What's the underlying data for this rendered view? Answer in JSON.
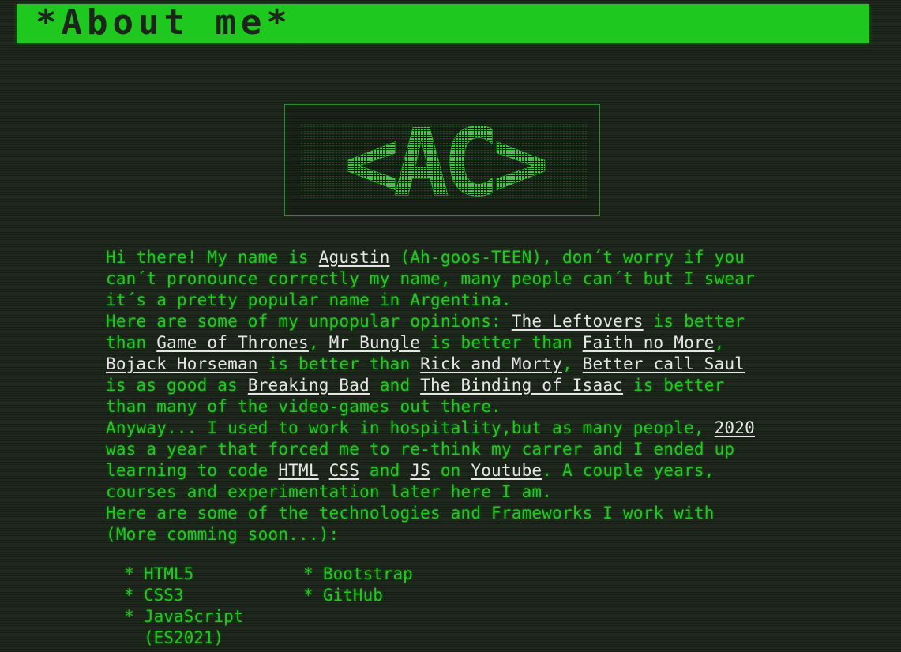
{
  "header": {
    "title": "*About me*"
  },
  "logo": {
    "text": "<AC>"
  },
  "intro": {
    "p1_a": "Hi there! My name is ",
    "name_link": "Agustin",
    "p1_b": " (Ah-goos-TEEN), don´t worry if you can´t pronounce correctly my name, many people can´t but I swear it´s a pretty popular name in Argentina."
  },
  "opinions": {
    "t1": "Here are some of my unpopular opinions: ",
    "link_leftovers": "The Leftovers",
    "t2": " is better than ",
    "link_got": "Game of Thrones",
    "t3": ", ",
    "link_mrbungle": "Mr Bungle",
    "t4": " is better than ",
    "link_faith": "Faith no More",
    "t5": ", ",
    "link_bojack": "Bojack Horseman",
    "t6": " is better than ",
    "link_rick": "Rick and Morty",
    "t7": ", ",
    "link_saul": "Better call Saul",
    "t8": " is as good as ",
    "link_bb": "Breaking Bad",
    "t9": " and ",
    "link_isaac": "The Binding of Isaac",
    "t10": " is better than many of the video-games out there."
  },
  "story": {
    "t1": "Anyway... I used to work in hospitality,but as many people, ",
    "link_2020": "2020",
    "t2": " was a year that forced me to re-think my carrer and I ended up learning to code ",
    "link_html": "HTML",
    "t3": " ",
    "link_css": "CSS",
    "t4": " and ",
    "link_js": "JS",
    "t5": " on ",
    "link_youtube": "Youtube",
    "t6": ". A couple years, courses and experimentation later here I am."
  },
  "tech_intro": "Here are some of the technologies and Frameworks I work with (More comming soon...):",
  "bullet": "*",
  "tech_list": {
    "col1": [
      "HTML5",
      "CSS3",
      "JavaScript (ES2021)"
    ],
    "col2": [
      "Bootstrap",
      "GitHub"
    ]
  },
  "colors": {
    "background": "#1b2519",
    "accent_green": "#1ec81e",
    "text_green": "#24c624",
    "link_white": "#e6e6e6"
  }
}
